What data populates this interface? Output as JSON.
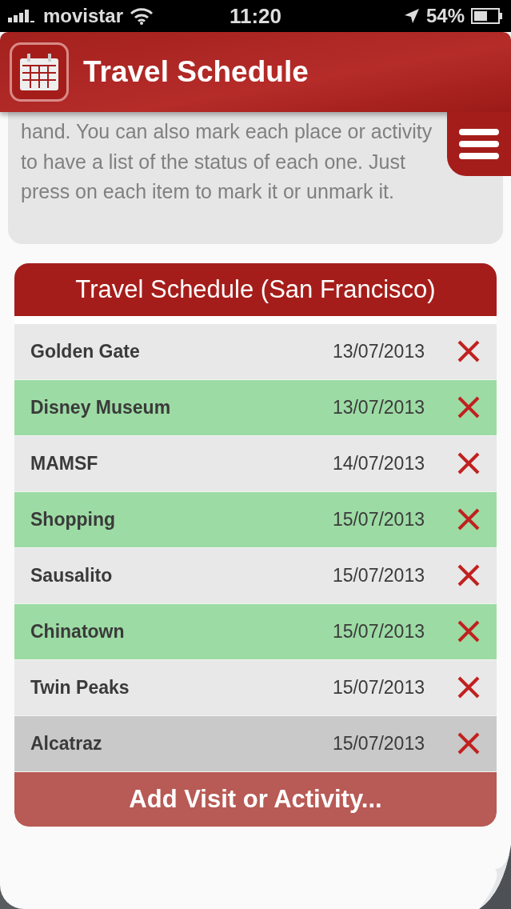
{
  "status_bar": {
    "carrier": "movistar",
    "time": "11:20",
    "battery": "54%"
  },
  "header": {
    "title": "Travel Schedule"
  },
  "description": "hand. You can also mark each place or activity to have a list of the status of each one. Just press on each item to mark it or unmark it.",
  "schedule": {
    "title": "Travel Schedule (San Francisco)",
    "rows": [
      {
        "name": "Golden Gate",
        "date": "13/07/2013",
        "marked": false,
        "selected": false
      },
      {
        "name": "Disney Museum",
        "date": "13/07/2013",
        "marked": true,
        "selected": false
      },
      {
        "name": "MAMSF",
        "date": "14/07/2013",
        "marked": false,
        "selected": false
      },
      {
        "name": "Shopping",
        "date": "15/07/2013",
        "marked": true,
        "selected": false
      },
      {
        "name": "Sausalito",
        "date": "15/07/2013",
        "marked": false,
        "selected": false
      },
      {
        "name": "Chinatown",
        "date": "15/07/2013",
        "marked": true,
        "selected": false
      },
      {
        "name": "Twin Peaks",
        "date": "15/07/2013",
        "marked": false,
        "selected": false
      },
      {
        "name": "Alcatraz",
        "date": "15/07/2013",
        "marked": false,
        "selected": true
      }
    ],
    "add_button": "Add Visit or Activity..."
  }
}
